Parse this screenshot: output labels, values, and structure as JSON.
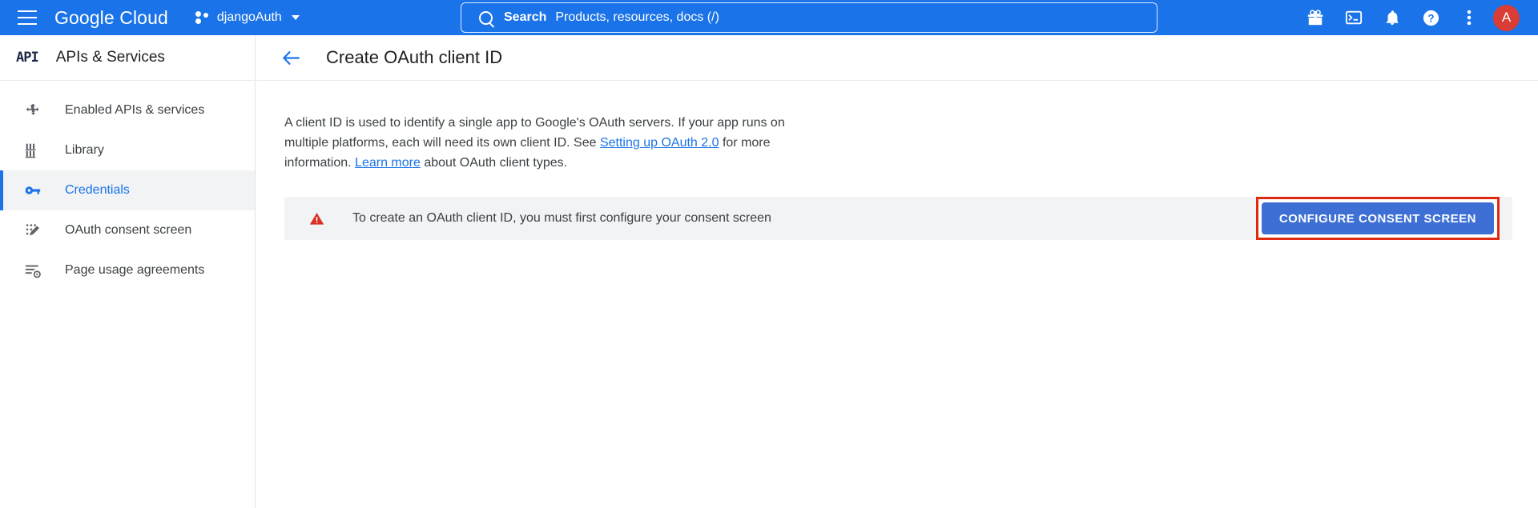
{
  "topbar": {
    "menu_icon": "hamburger-menu-icon",
    "brand": "Google Cloud",
    "project_name": "djangoAuth",
    "project_icon": "project-dots-icon",
    "caret_icon": "chevron-down-icon",
    "search": {
      "icon": "search-icon",
      "label": "Search",
      "placeholder": "Products, resources, docs (/)"
    },
    "actions": [
      {
        "name": "gift-icon",
        "label": ""
      },
      {
        "name": "cloud-shell-terminal-icon",
        "label": ""
      },
      {
        "name": "notifications-bell-icon",
        "label": ""
      },
      {
        "name": "help-question-icon",
        "label": ""
      },
      {
        "name": "more-vertical-dots-icon",
        "label": ""
      }
    ],
    "avatar_letter": "A",
    "avatar_color": "#d93d35",
    "bar_color": "#1a73e8"
  },
  "sidebar": {
    "logo_text": "API",
    "title": "APIs & Services",
    "items": [
      {
        "label": "Enabled APIs & services",
        "icon": "enabled-apis-icon",
        "active": false
      },
      {
        "label": "Library",
        "icon": "library-icon",
        "active": false
      },
      {
        "label": "Credentials",
        "icon": "key-credentials-icon",
        "active": true
      },
      {
        "label": "OAuth consent screen",
        "icon": "oauth-consent-icon",
        "active": false
      },
      {
        "label": "Page usage agreements",
        "icon": "page-usage-agreements-icon",
        "active": false
      }
    ],
    "active_color": "#1a73e8"
  },
  "main": {
    "back_icon": "back-arrow-icon",
    "page_title": "Create OAuth client ID",
    "description": {
      "part1": "A client ID is used to identify a single app to Google's OAuth servers. If your app runs on multiple platforms, each will need its own client ID. See ",
      "link1": "Setting up OAuth 2.0",
      "part2": " for more information. ",
      "link2": "Learn more",
      "part3": " about OAuth client types."
    },
    "warning": {
      "icon": "warning-triangle-icon",
      "icon_color": "#d93025",
      "text": "To create an OAuth client ID, you must first configure your consent screen",
      "button_label": "CONFIGURE CONSENT SCREEN",
      "button_color": "#3d6fd4",
      "highlight_color": "#e02a10"
    }
  }
}
